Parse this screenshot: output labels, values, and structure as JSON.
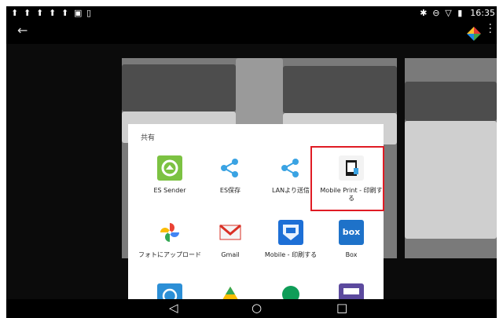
{
  "status_bar": {
    "time": "16:35",
    "left_icons": [
      "notification-icon",
      "notification-icon",
      "notification-icon",
      "notification-icon",
      "notification-icon",
      "image-icon",
      "download-icon"
    ],
    "right_icons": [
      "bluetooth-icon",
      "do-not-disturb-icon",
      "wifi-icon",
      "battery-icon"
    ]
  },
  "action_bar": {
    "back_icon": "back-arrow-icon",
    "menu_icon": "overflow-menu-icon"
  },
  "share_sheet": {
    "title": "共有",
    "apps": [
      {
        "label": "ES Sender",
        "icon": "es-sender-icon",
        "color": "#7cc242"
      },
      {
        "label": "ES保存",
        "icon": "share-es-icon",
        "color": "#3aa3e3"
      },
      {
        "label": "LANより送信",
        "icon": "share-lan-icon",
        "color": "#3aa3e3"
      },
      {
        "label": "Mobile Print - 印刷する",
        "icon": "mobile-print-icon",
        "color": "#1a1a1a"
      },
      {
        "label": "フォトにアップロード",
        "icon": "google-photos-icon",
        "color": "#4285f4"
      },
      {
        "label": "Gmail",
        "icon": "gmail-icon",
        "color": "#d93025"
      },
      {
        "label": "Mobile - 印刷する",
        "icon": "mobile-print-app-icon",
        "color": "#1d6fd6"
      },
      {
        "label": "Box",
        "icon": "box-icon",
        "color": "#1e72c9"
      },
      {
        "label": "",
        "icon": "scan-app-icon",
        "color": "#2c8fd6"
      },
      {
        "label": "",
        "icon": "google-drive-icon",
        "color": "#fbbc04"
      },
      {
        "label": "",
        "icon": "hangouts-icon",
        "color": "#0f9d58"
      },
      {
        "label": "",
        "icon": "printer-app-icon",
        "color": "#5c4a9e"
      }
    ]
  },
  "nav_bar": {
    "back": "◁",
    "home": "○",
    "recents": "□"
  }
}
